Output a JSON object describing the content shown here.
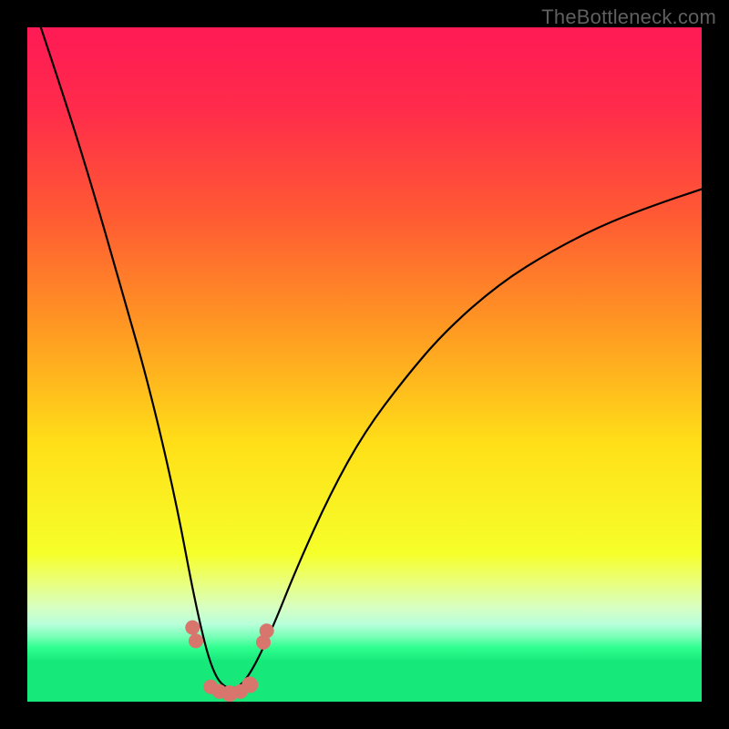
{
  "watermark": "TheBottleneck.com",
  "colors": {
    "bg_black": "#000000",
    "curve": "#000000",
    "dots": "#d8766e",
    "gradient_stops": [
      {
        "pos": 0.0,
        "color": "#ff1a55"
      },
      {
        "pos": 0.12,
        "color": "#ff2b4b"
      },
      {
        "pos": 0.28,
        "color": "#ff5a33"
      },
      {
        "pos": 0.45,
        "color": "#ff9a22"
      },
      {
        "pos": 0.62,
        "color": "#ffe018"
      },
      {
        "pos": 0.78,
        "color": "#f6ff2a"
      },
      {
        "pos": 0.82,
        "color": "#eaff76"
      },
      {
        "pos": 0.86,
        "color": "#d8ffc2"
      },
      {
        "pos": 0.885,
        "color": "#b8ffda"
      },
      {
        "pos": 0.905,
        "color": "#73ffb4"
      },
      {
        "pos": 0.92,
        "color": "#2fff8f"
      },
      {
        "pos": 0.94,
        "color": "#17e87a"
      },
      {
        "pos": 1.0,
        "color": "#17e87a"
      }
    ]
  },
  "chart_data": {
    "type": "line",
    "title": "",
    "xlabel": "",
    "ylabel": "",
    "xlim": [
      0,
      1
    ],
    "ylim": [
      0,
      1
    ],
    "note": "V-shaped bottleneck curve. y is the curve height normalized 0..1 (0 = bottom / green / no bottleneck, 1 = top / red / max bottleneck). x is normalized horizontal position across the plot area. Minimum (optimal match) is around x≈0.30.",
    "series": [
      {
        "name": "curve",
        "x": [
          0.02,
          0.06,
          0.1,
          0.14,
          0.18,
          0.22,
          0.25,
          0.275,
          0.3,
          0.325,
          0.36,
          0.4,
          0.45,
          0.5,
          0.56,
          0.62,
          0.7,
          0.78,
          0.86,
          0.94,
          1.0
        ],
        "y": [
          1.0,
          0.88,
          0.75,
          0.61,
          0.47,
          0.3,
          0.14,
          0.04,
          0.015,
          0.03,
          0.1,
          0.2,
          0.31,
          0.4,
          0.48,
          0.55,
          0.62,
          0.67,
          0.71,
          0.74,
          0.76
        ]
      },
      {
        "name": "dots",
        "kind": "points",
        "x": [
          0.245,
          0.25,
          0.272,
          0.285,
          0.3,
          0.316,
          0.33,
          0.35,
          0.355
        ],
        "y": [
          0.11,
          0.09,
          0.022,
          0.015,
          0.012,
          0.015,
          0.025,
          0.088,
          0.105
        ],
        "r": [
          8,
          8,
          8,
          8,
          9,
          8,
          9,
          8,
          8
        ]
      }
    ]
  }
}
